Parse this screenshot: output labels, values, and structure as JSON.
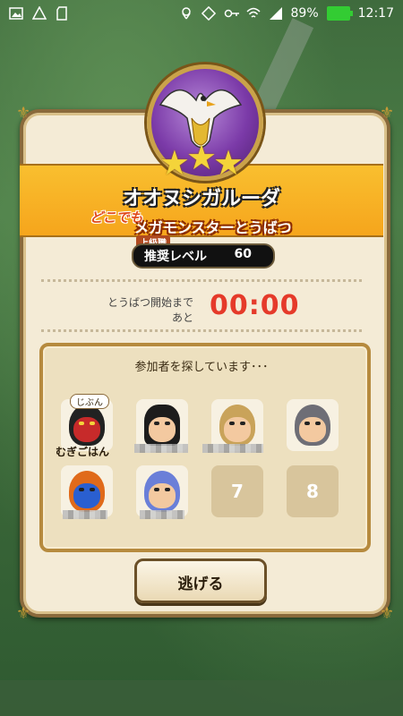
{
  "status_bar": {
    "battery": "89%",
    "time": "12:17"
  },
  "monster": {
    "name": "オオヌシガルーダ",
    "event_prefix": "どこでも",
    "event_name": "メガモンスターとうばつ",
    "stars": 3,
    "tier": "上級職"
  },
  "level": {
    "label": "推奨レベル",
    "value": "60"
  },
  "countdown": {
    "label_line1": "とうばつ開始まで",
    "label_line2": "あと",
    "time": "00:00"
  },
  "participants": {
    "title": "参加者を探しています･･･",
    "self_badge": "じぶん",
    "self_name": "むぎごはん",
    "empty_slots": [
      "7",
      "8"
    ]
  },
  "escape_button": "逃げる",
  "colors": {
    "banner": "#f6a51c",
    "countdown": "#e53a2a",
    "panel": "#f4ebd6"
  }
}
